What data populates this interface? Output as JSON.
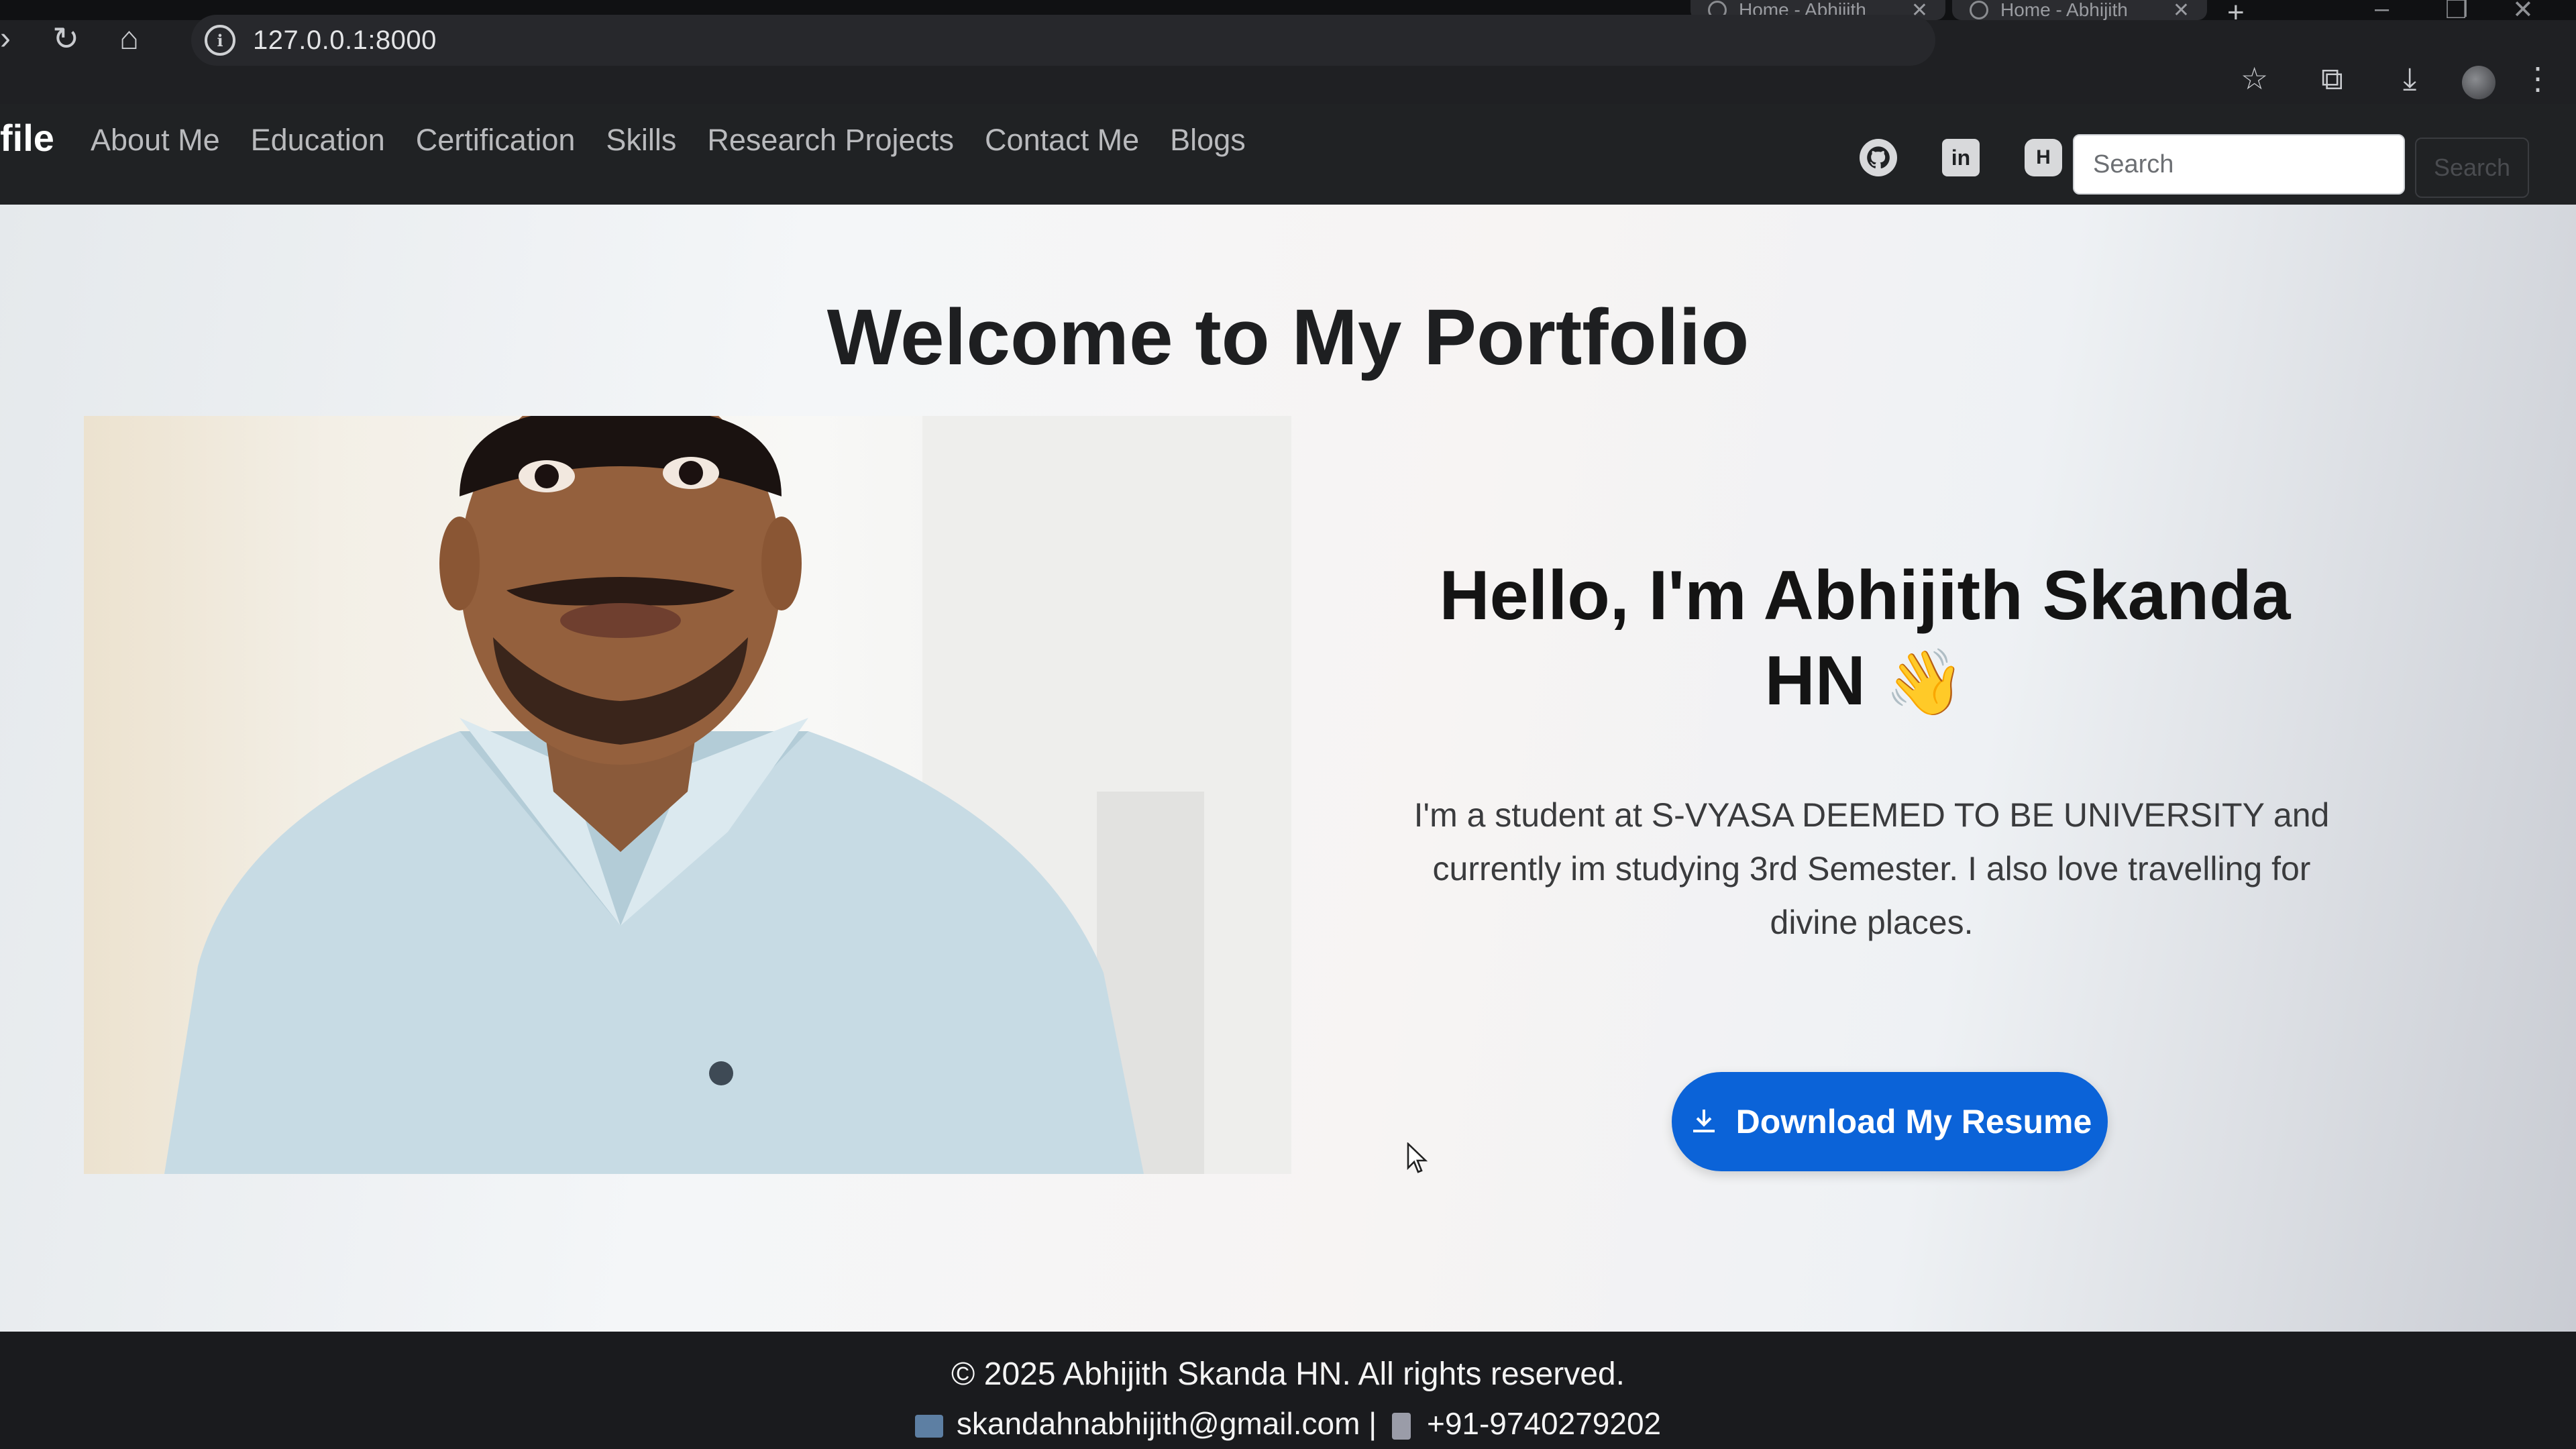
{
  "browser": {
    "url": "127.0.0.1:8000",
    "tabs": [
      {
        "title": "Home - Abhijith"
      },
      {
        "title": "Home - Abhijith"
      }
    ],
    "new_tab_glyph": "+",
    "close_glyph": "✕",
    "icons": [
      "back-icon",
      "reload-icon",
      "home-icon",
      "info-icon",
      "star-icon",
      "extensions-icon",
      "download-icon",
      "profile-icon",
      "more-icon"
    ]
  },
  "navbar": {
    "brand": "file",
    "links": [
      "About Me",
      "Education",
      "Certification",
      "Skills",
      "Research Projects",
      "Contact Me",
      "Blogs"
    ],
    "social_icons": [
      "github-icon",
      "linkedin-icon",
      "hashnode-icon"
    ],
    "search": {
      "placeholder": "Search",
      "button": "Search"
    }
  },
  "hero": {
    "welcome": "Welcome to My Portfolio",
    "hello_line1": "Hello, I'm Abhijith Skanda",
    "hello_line2": "HN",
    "wave": "👋",
    "bio": "I'm a student at S-VYASA DEEMED TO BE UNIVERSITY and currently im studying 3rd Semester. I also love travelling for divine places.",
    "button": "Download My Resume"
  },
  "footer": {
    "copyright": "© 2025 Abhijith Skanda HN. All rights reserved.",
    "email": "skandahnabhijith@gmail.com",
    "separator": "|",
    "phone": "+91-9740279202"
  },
  "colors": {
    "navbar_bg": "#202224",
    "button_blue": "#0b63d8",
    "footer_bg": "#1a1b1e"
  }
}
